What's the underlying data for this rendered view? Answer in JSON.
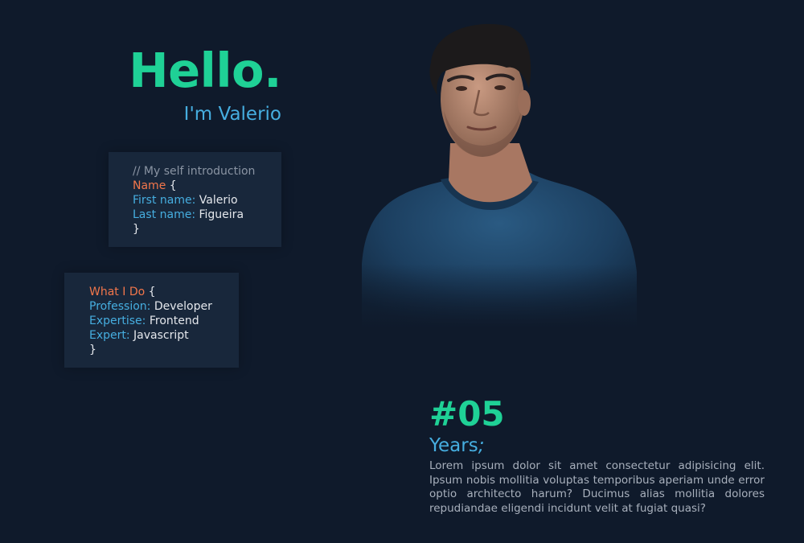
{
  "hero": {
    "greeting": "Hello.",
    "subtitle": "I'm Valerio"
  },
  "intro_card": {
    "comment": "// My self introduction",
    "block_name": "Name",
    "open_brace": "{",
    "close_brace": "}",
    "fields": [
      {
        "key": "First name:",
        "value": "Valerio"
      },
      {
        "key": "Last name:",
        "value": "Figueira"
      }
    ]
  },
  "work_card": {
    "block_name": "What I Do",
    "open_brace": "{",
    "close_brace": "}",
    "fields": [
      {
        "key": "Profession:",
        "value": "Developer"
      },
      {
        "key": "Expertise:",
        "value": "Frontend"
      },
      {
        "key": "Expert:",
        "value": "Javascript"
      }
    ]
  },
  "experience": {
    "number": "#05",
    "label": "Years",
    "label_suffix": ";",
    "description": "Lorem ipsum dolor sit amet consectetur adipisicing elit. Ipsum nobis mollitia voluptas temporibus aperiam unde error optio architecto harum? Ducimus alias mollitia dolores repudiandae eligendi incidunt velit at fugiat quasi?"
  },
  "colors": {
    "background": "#0f1a2b",
    "card": "#18273b",
    "accent_green": "#1fd196",
    "accent_blue": "#46aee0",
    "accent_orange": "#f2764b"
  }
}
